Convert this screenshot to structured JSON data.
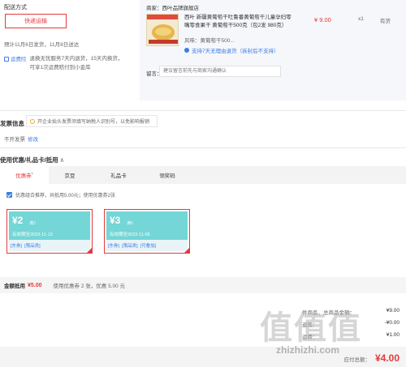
{
  "shipping": {
    "title": "配送方式",
    "method": "快递运输",
    "estimate": "预计11月6日发货，11月8日送达",
    "insurance_badge": "运费险",
    "insurance_text": [
      "退换无忧服务7天内退货，15天内换货，",
      "可享1次运费赔付到小金库"
    ]
  },
  "order": {
    "shop": "商家：西叶品牌旗舰店",
    "product_title": "西叶 新疆黄葡萄干吐鲁番黄葡萄干儿童孕妇零嘴零食果干 黄葡萄干500克（包2发 980克）",
    "price": "¥ 9.00",
    "qty": "x1",
    "stock": "有货",
    "flavor": "风味：黄葡萄干500...",
    "return_policy": "支持7天无理由退货（拆封后不支持）",
    "remark_label": "留言：",
    "remark_placeholder": "建议留言前先与商家沟通确认"
  },
  "invoice": {
    "title": "发票信息",
    "tip": "开企业抬头发票须填写纳税人识别号，以免影响报销",
    "status": "不开发票",
    "edit_link": "修改"
  },
  "coupons": {
    "title": "使用优惠/礼品卡/抵用",
    "chevron": "∧",
    "tabs": [
      {
        "label": "优惠券",
        "active": true,
        "mark": "*"
      },
      {
        "label": "京豆",
        "active": false
      },
      {
        "label": "礼品卡",
        "active": false
      },
      {
        "label": "领奖码",
        "active": false
      }
    ],
    "combo_text": "优惠组合推荐，共抵用5.00元；使用优惠券2张",
    "items": [
      {
        "amount": "¥2",
        "condition": "满3",
        "valid": "有效期至2023-11-13",
        "tags": [
          "[东券]",
          "[限品类]"
        ]
      },
      {
        "amount": "¥3",
        "condition": "满6",
        "valid": "有效期至2023-11-05",
        "tags": [
          "[东券]",
          "[限品类]",
          "[可叠加]"
        ]
      }
    ],
    "summary_label": "金额抵用",
    "summary_amount": "¥5.00",
    "summary_desc": "使用优惠券 2 张，优惠 5.00 元"
  },
  "totals": {
    "rows": [
      {
        "label": "件商品，总商品金额：",
        "value": "¥9.00"
      },
      {
        "label": "返现：",
        "value": "-¥0.00"
      },
      {
        "label": "运费：",
        "value": "¥1.00"
      }
    ],
    "payable_label": "应付总额：",
    "payable_value": "¥4.00"
  },
  "watermark": {
    "text": "值值值",
    "url": "zhizhizhi.com"
  },
  "colors": {
    "accent": "#e4393c",
    "link": "#3c7be5",
    "coupon": "#74d6d6"
  }
}
